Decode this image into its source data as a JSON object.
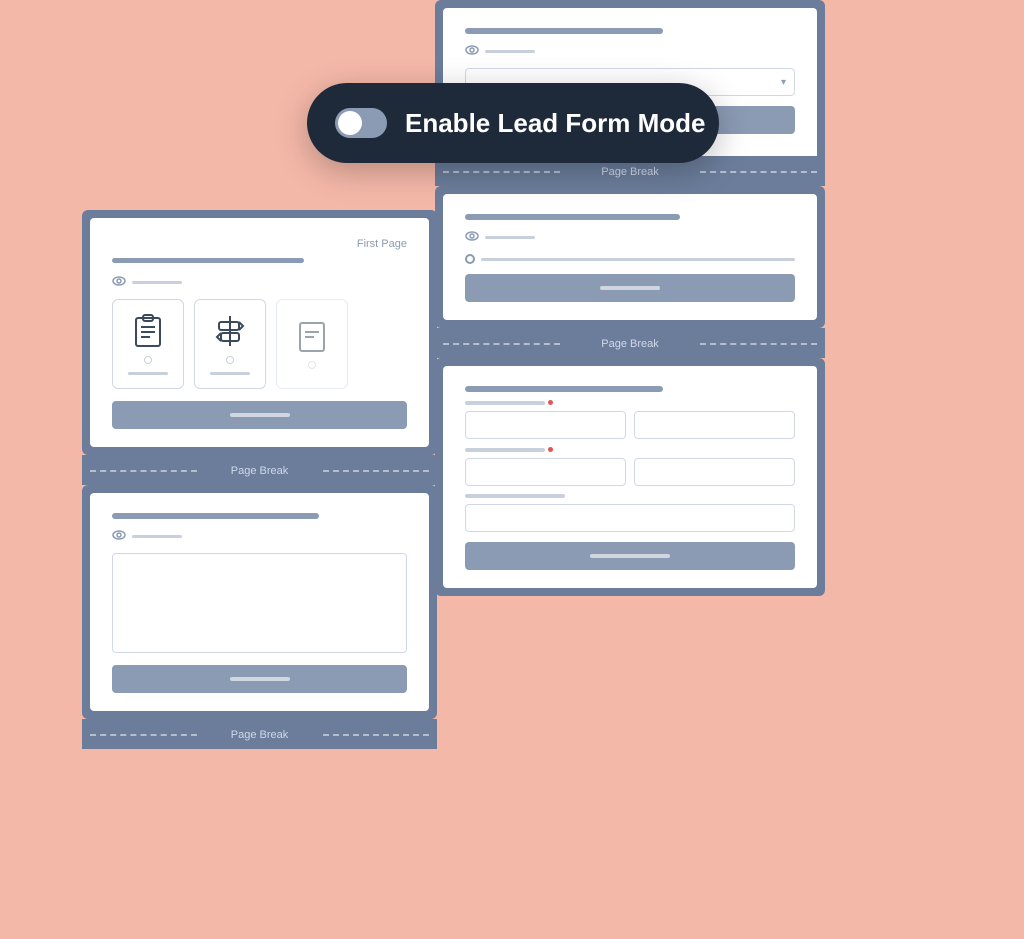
{
  "background": "#f4b8a8",
  "toggle": {
    "label": "Enable Lead Form Mode",
    "enabled": false
  },
  "left_stack": {
    "page1": {
      "label": "First Page",
      "has_icon_cards": true,
      "btn_label": ""
    },
    "break1": {
      "label": "Page Break"
    },
    "page2": {
      "has_textarea": true
    },
    "break2": {
      "label": "Page Break"
    }
  },
  "right_stack": {
    "page0": {
      "has_input": true,
      "has_dropdown": true
    },
    "break1": {
      "label": "Page Break"
    },
    "page2": {
      "has_slider": true
    },
    "break2": {
      "label": "Page Break"
    },
    "page3": {
      "has_two_col_inputs": true
    }
  }
}
